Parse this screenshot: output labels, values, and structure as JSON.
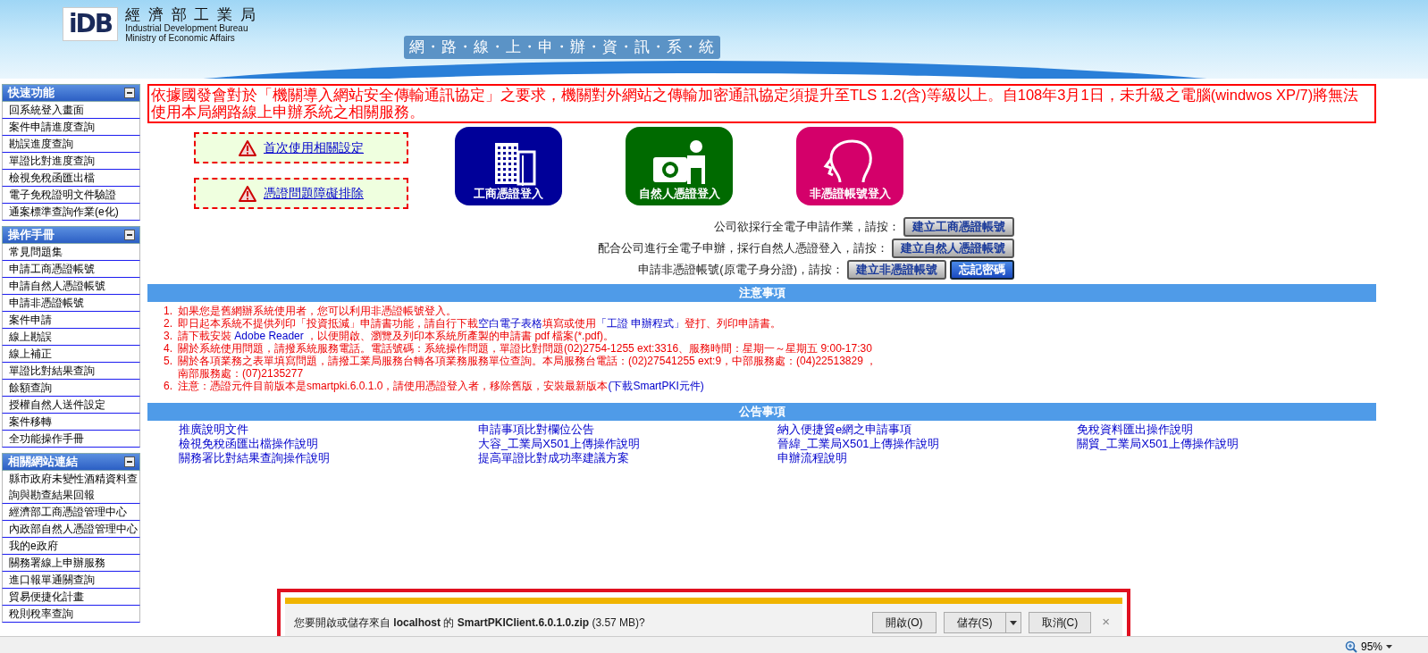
{
  "header": {
    "logo_text": "iDB",
    "org_name_zh": "經 濟 部 工 業 局",
    "org_name_en_1": "Industrial Development Bureau",
    "org_name_en_2": "Ministry of Economic Affairs",
    "system_title": "網・路・線・上・申・辦・資・訊・系・統"
  },
  "sidebar": {
    "sections": [
      {
        "title": "快速功能",
        "expanded": true,
        "items": [
          "回系統登入畫面",
          "案件申請進度查詢",
          "勘誤進度查詢",
          "單證比對進度查詢",
          "檢視免稅函匯出檔",
          "電子免稅證明文件驗證",
          "通案標準查詢作業(e化)"
        ]
      },
      {
        "title": "操作手冊",
        "expanded": true,
        "items": [
          "常見問題集",
          "申請工商憑證帳號",
          "申請自然人憑證帳號",
          "申請非憑證帳號",
          "案件申請",
          "線上勘誤",
          "線上補正",
          "單證比對結果查詢",
          "餘額查詢",
          "授權自然人送件設定",
          "案件移轉",
          "全功能操作手冊"
        ]
      },
      {
        "title": "相關網站連結",
        "expanded": true,
        "items": [
          "縣市政府未變性酒精資料查詢與勘查結果回報",
          "經濟部工商憑證管理中心",
          "內政部自然人憑證管理中心",
          "我的e政府",
          "關務署線上申辦服務",
          "進口報單通關查詢",
          "貿易便捷化計畫",
          "稅則稅率查詢"
        ]
      }
    ]
  },
  "notice": "依據國發會對於「機關導入網站安全傳輸通訊協定」之要求，機關對外網站之傳輸加密通訊協定須提升至TLS 1.2(含)等級以上。自108年3月1日，未升級之電腦(windwos XP/7)將無法使用本局網路線上申辦系統之相關服務。",
  "help_links": [
    "首次使用相關設定",
    "憑證問題障礙排除"
  ],
  "login_tiles": [
    {
      "kind": "company",
      "label": "工商憑證登入"
    },
    {
      "kind": "person",
      "label": "自然人憑證登入"
    },
    {
      "kind": "none",
      "label": "非憑證帳號登入"
    }
  ],
  "account_rows": [
    {
      "prompt": "公司欲採行全電子申請作業，請按：",
      "buttons": [
        {
          "label": "建立工商憑證帳號",
          "kind": "grey"
        }
      ]
    },
    {
      "prompt": "配合公司進行全電子申辦，採行自然人憑證登入，請按：",
      "buttons": [
        {
          "label": "建立自然人憑證帳號",
          "kind": "grey"
        }
      ]
    },
    {
      "prompt": "申請非憑證帳號(原電子身分證)，請按：",
      "buttons": [
        {
          "label": "建立非憑證帳號",
          "kind": "grey"
        },
        {
          "label": "忘記密碼",
          "kind": "blue"
        }
      ]
    }
  ],
  "notes": {
    "title": "注意事項",
    "items": [
      {
        "number": "1.",
        "parts": [
          {
            "text": "如果您是舊網辦系統使用者，您可以利用非憑證帳號登入。",
            "link": false
          }
        ]
      },
      {
        "number": "2.",
        "parts": [
          {
            "text": "即日起本系統不提供列印「投資抵減」申請書功能，請自行下載",
            "link": false
          },
          {
            "text": "空白電子表格",
            "link": true
          },
          {
            "text": "填寫或使用",
            "link": false
          },
          {
            "text": "「工證 申辦程式」",
            "link": true
          },
          {
            "text": "登打、列印申請書。",
            "link": false
          }
        ]
      },
      {
        "number": "3.",
        "parts": [
          {
            "text": "請下載安裝 ",
            "link": false
          },
          {
            "text": "Adobe Reader",
            "link": true
          },
          {
            "text": " ，以便開啟、瀏覽及列印本系統所產製的申請書 pdf 檔案(*.pdf)。",
            "link": false
          }
        ]
      },
      {
        "number": "4.",
        "parts": [
          {
            "text": "關於系統使用問題，請撥系統服務電話。電話號碼：系統操作問題，單證比對問題(02)2754-1255 ext:3316、服務時間：星期一～星期五 9:00-17:30",
            "link": false
          }
        ]
      },
      {
        "number": "5.",
        "parts": [
          {
            "text": "關於各項業務之表單填寫問題，請撥工業局服務台轉各項業務服務單位查詢。本局服務台電話：(02)27541255 ext:9，中部服務處：(04)22513829 ，",
            "link": false
          },
          {
            "text": "南部服務處：(07)2135277",
            "link": false,
            "new_line": true
          }
        ]
      },
      {
        "number": "6.",
        "parts": [
          {
            "text": "注意：憑證元件目前版本是smartpki.6.0.1.0，請使用憑證登入者，移除舊版，安裝最新版本",
            "link": false
          },
          {
            "text": "(下載SmartPKI元件)",
            "link": true
          }
        ]
      }
    ]
  },
  "announcements": {
    "title": "公告事項",
    "columns": [
      [
        "推廣說明文件",
        "檢視免稅函匯出檔操作說明",
        "關務署比對結果查詢操作說明"
      ],
      [
        "申請事項比對欄位公告",
        "大容_工業局X501上傳操作說明",
        "提高單證比對成功率建議方案"
      ],
      [
        "納入便捷貿e網之申請事項",
        "晉緯_工業局X501上傳操作說明",
        "申辦流程說明"
      ],
      [
        "免稅資料匯出操作說明",
        "關貿_工業局X501上傳操作說明"
      ]
    ]
  },
  "download_bar": {
    "message": "您要開啟或儲存來自 **localhost** 的 **SmartPKIClient.6.0.1.0.zip** (3.57 MB)?",
    "buttons": [
      {
        "label": "開啟(O)",
        "kind": "plain"
      },
      {
        "label": "儲存(S)",
        "kind": "split"
      },
      {
        "label": "取消(C)",
        "kind": "plain"
      }
    ],
    "close": "×"
  },
  "status_bar": {
    "zoom": "95%"
  }
}
